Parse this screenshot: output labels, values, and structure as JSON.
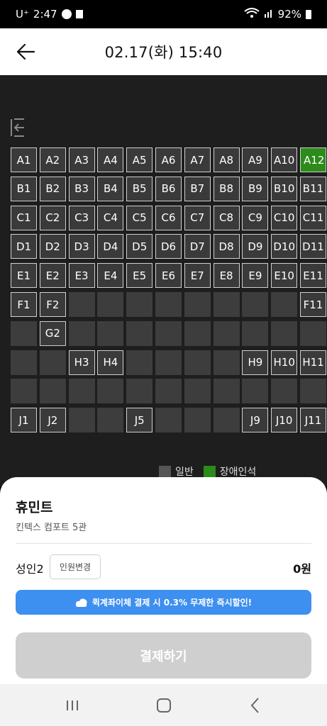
{
  "status": {
    "carrier": "U⁺",
    "time": "2:47",
    "battery": "92%"
  },
  "header": {
    "title": "02.17(화) 15:40"
  },
  "seats": {
    "rows": [
      {
        "row": "A",
        "cells": [
          "A1",
          "A2",
          "A3",
          "A4",
          "A5",
          "A6",
          "A7",
          "A8",
          "A9",
          "A10",
          "A12"
        ],
        "types": [
          "a",
          "a",
          "a",
          "a",
          "a",
          "a",
          "a",
          "a",
          "a",
          "a",
          "d"
        ]
      },
      {
        "row": "B",
        "cells": [
          "B1",
          "B2",
          "B3",
          "B4",
          "B5",
          "B6",
          "B7",
          "B8",
          "B9",
          "B10",
          "B11"
        ],
        "types": [
          "a",
          "a",
          "a",
          "a",
          "a",
          "a",
          "a",
          "a",
          "a",
          "a",
          "a"
        ]
      },
      {
        "row": "C",
        "cells": [
          "C1",
          "C2",
          "C3",
          "C4",
          "C5",
          "C6",
          "C7",
          "C8",
          "C9",
          "C10",
          "C11"
        ],
        "types": [
          "a",
          "a",
          "a",
          "a",
          "a",
          "a",
          "a",
          "a",
          "a",
          "a",
          "a"
        ]
      },
      {
        "row": "D",
        "cells": [
          "D1",
          "D2",
          "D3",
          "D4",
          "D5",
          "D6",
          "D7",
          "D8",
          "D9",
          "D10",
          "D11"
        ],
        "types": [
          "a",
          "a",
          "a",
          "a",
          "a",
          "a",
          "a",
          "a",
          "a",
          "a",
          "a"
        ]
      },
      {
        "row": "E",
        "cells": [
          "E1",
          "E2",
          "E3",
          "E4",
          "E5",
          "E6",
          "E7",
          "E8",
          "E9",
          "E10",
          "E11"
        ],
        "types": [
          "a",
          "a",
          "a",
          "a",
          "a",
          "a",
          "a",
          "a",
          "a",
          "a",
          "a"
        ]
      },
      {
        "row": "F",
        "cells": [
          "F1",
          "F2",
          "",
          "",
          "",
          "",
          "",
          "",
          "",
          "",
          "F11"
        ],
        "types": [
          "a",
          "a",
          "e",
          "e",
          "e",
          "e",
          "e",
          "e",
          "e",
          "e",
          "a"
        ]
      },
      {
        "row": "G",
        "cells": [
          "",
          "G2",
          "",
          "",
          "",
          "",
          "",
          "",
          "",
          "",
          ""
        ],
        "types": [
          "e",
          "a",
          "e",
          "e",
          "e",
          "e",
          "e",
          "e",
          "e",
          "e",
          "e"
        ]
      },
      {
        "row": "H",
        "cells": [
          "",
          "",
          "H3",
          "H4",
          "",
          "",
          "",
          "",
          "H9",
          "H10",
          "H11"
        ],
        "types": [
          "e",
          "e",
          "a",
          "a",
          "e",
          "e",
          "e",
          "e",
          "a",
          "a",
          "a"
        ]
      },
      {
        "row": "I",
        "cells": [
          "",
          "",
          "",
          "",
          "",
          "",
          "",
          "",
          "",
          "",
          ""
        ],
        "types": [
          "e",
          "e",
          "e",
          "e",
          "e",
          "e",
          "e",
          "e",
          "e",
          "e",
          "e"
        ]
      },
      {
        "row": "J",
        "cells": [
          "J1",
          "J2",
          "",
          "",
          "J5",
          "",
          "",
          "",
          "J9",
          "J10",
          "J11"
        ],
        "types": [
          "a",
          "a",
          "e",
          "e",
          "a",
          "e",
          "e",
          "e",
          "a",
          "a",
          "a"
        ]
      }
    ]
  },
  "legend": {
    "general": "일반",
    "disabled": "장애인석",
    "general_color": "#555555",
    "disabled_color": "#2c8b1a"
  },
  "sheet": {
    "theater_name": "휴민트",
    "theater_sub": "킨텍스 컴포트 5관",
    "people_label": "성인2",
    "change_button": "인원변경",
    "price": "0원",
    "promo_text": "퀵계좌이체 결제 시 0.3% 무제한 즉시할인!",
    "pay_button": "결제하기"
  },
  "colors": {
    "promo": "#3d8ff0",
    "pay_disabled": "#cfcfcf"
  }
}
